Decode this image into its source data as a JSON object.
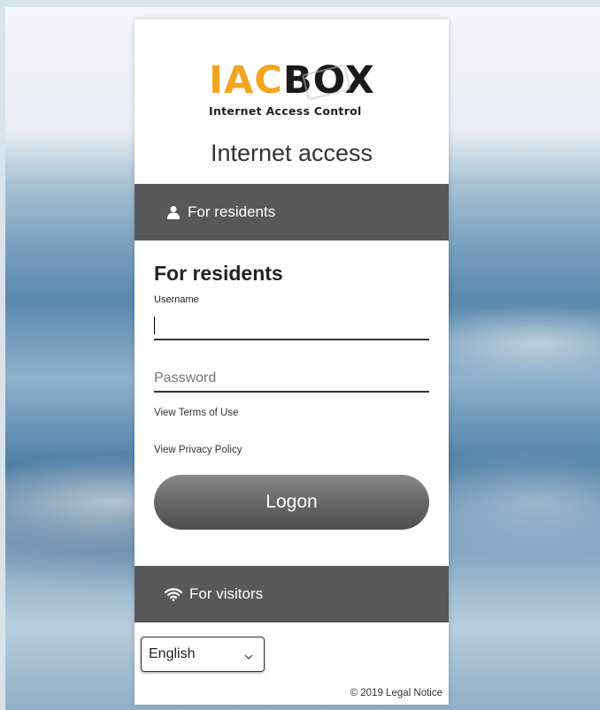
{
  "brand": {
    "name_part1": "IAC",
    "name_part2": "BOX",
    "tagline": "Internet Access Control",
    "accent_color": "#f2a51f"
  },
  "page_title": "Internet access",
  "residents_header": {
    "label": "For residents",
    "icon": "user-icon"
  },
  "residents_form": {
    "title": "For residents",
    "username_label": "Username",
    "username_value": "",
    "password_placeholder": "Password",
    "terms_link": "View Terms of Use",
    "privacy_link": "View Privacy Policy",
    "logon_label": "Logon"
  },
  "visitors_header": {
    "label": "For visitors",
    "icon": "wifi-icon"
  },
  "language": {
    "selected": "English",
    "icon": "chevron-down-icon"
  },
  "footer": {
    "legal": "© 2019 Legal Notice"
  },
  "colors": {
    "header_bg": "#585858",
    "button_gradient_top": "#8a8a8a",
    "button_gradient_bottom": "#4e4e4e"
  }
}
